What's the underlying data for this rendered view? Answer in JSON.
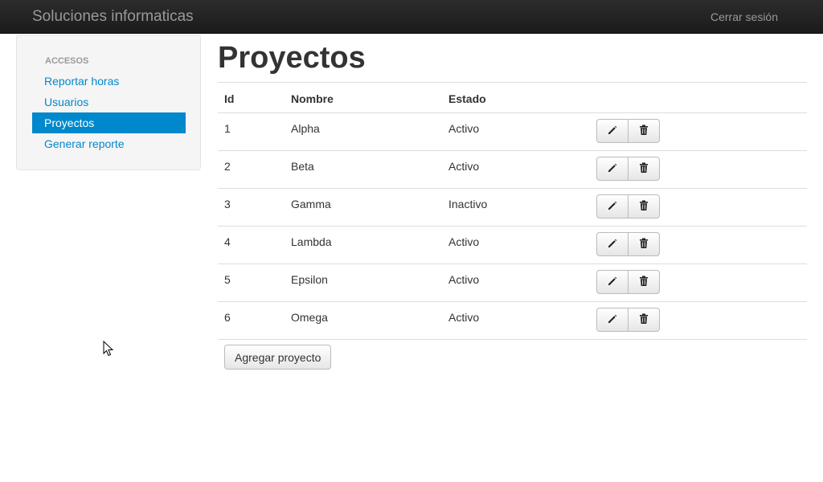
{
  "header": {
    "brand": "Soluciones informaticas",
    "logout_label": "Cerrar sesión"
  },
  "sidebar": {
    "header": "ACCESOS",
    "items": [
      {
        "label": "Reportar horas",
        "active": false
      },
      {
        "label": "Usuarios",
        "active": false
      },
      {
        "label": "Proyectos",
        "active": true
      },
      {
        "label": "Generar reporte",
        "active": false
      }
    ]
  },
  "main": {
    "title": "Proyectos",
    "table": {
      "columns": [
        "Id",
        "Nombre",
        "Estado"
      ],
      "rows": [
        {
          "id": "1",
          "nombre": "Alpha",
          "estado": "Activo"
        },
        {
          "id": "2",
          "nombre": "Beta",
          "estado": "Activo"
        },
        {
          "id": "3",
          "nombre": "Gamma",
          "estado": "Inactivo"
        },
        {
          "id": "4",
          "nombre": "Lambda",
          "estado": "Activo"
        },
        {
          "id": "5",
          "nombre": "Epsilon",
          "estado": "Activo"
        },
        {
          "id": "6",
          "nombre": "Omega",
          "estado": "Activo"
        }
      ],
      "row_actions": [
        "pencil-icon",
        "trash-icon"
      ]
    },
    "add_button_label": "Agregar proyecto"
  },
  "colors": {
    "accent": "#0088cc",
    "navbar": "#1b1b1b",
    "sidebar_bg": "#f5f5f5",
    "text": "#333333"
  }
}
